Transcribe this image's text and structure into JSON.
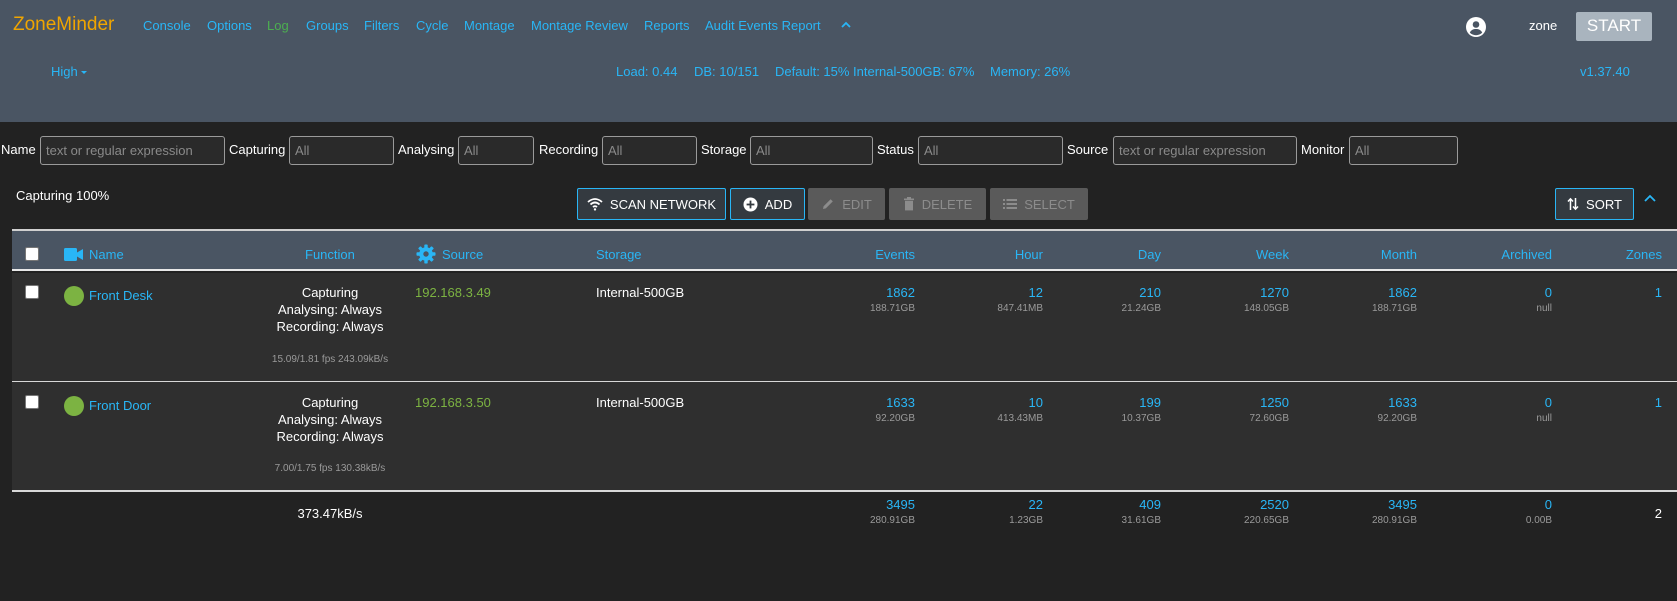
{
  "app": {
    "title": "ZoneMinder"
  },
  "nav": {
    "items": [
      "Console",
      "Options",
      "Log",
      "Groups",
      "Filters",
      "Cycle",
      "Montage",
      "Montage Review",
      "Reports",
      "Audit Events Report"
    ],
    "active": "Log"
  },
  "user": {
    "name": "zone"
  },
  "start_label": "START",
  "bandwidth": "High",
  "system": {
    "load": "Load: 0.44",
    "db": "DB: 10/151",
    "storage": "Default: 15% Internal-500GB: 67%",
    "memory": "Memory: 26%",
    "version": "v1.37.40"
  },
  "filters": {
    "name_label": "Name",
    "name_placeholder": "text or regular expression",
    "capturing_label": "Capturing",
    "capturing_value": "All",
    "analysing_label": "Analysing",
    "analysing_value": "All",
    "recording_label": "Recording",
    "recording_value": "All",
    "storage_label": "Storage",
    "storage_value": "All",
    "status_label": "Status",
    "status_value": "All",
    "source_label": "Source",
    "source_placeholder": "text or regular expression",
    "monitor_label": "Monitor",
    "monitor_value": "All"
  },
  "toolbar": {
    "capturing_status": "Capturing 100%",
    "scan_network": "SCAN NETWORK",
    "add": "ADD",
    "edit": "EDIT",
    "delete": "DELETE",
    "select": "SELECT",
    "sort": "SORT"
  },
  "table": {
    "headers": {
      "name": "Name",
      "function": "Function",
      "source": "Source",
      "storage": "Storage",
      "events": "Events",
      "hour": "Hour",
      "day": "Day",
      "week": "Week",
      "month": "Month",
      "archived": "Archived",
      "zones": "Zones"
    },
    "rows": [
      {
        "name": "Front Desk",
        "func": [
          "Capturing",
          "Analysing: Always",
          "Recording: Always"
        ],
        "fps": "15.09/1.81 fps 243.09kB/s",
        "source": "192.168.3.49",
        "storage": "Internal-500GB",
        "events": "1862",
        "events_size": "188.71GB",
        "hour": "12",
        "hour_size": "847.41MB",
        "day": "210",
        "day_size": "21.24GB",
        "week": "1270",
        "week_size": "148.05GB",
        "month": "1862",
        "month_size": "188.71GB",
        "archived": "0",
        "archived_size": "null",
        "zones": "1"
      },
      {
        "name": "Front Door",
        "func": [
          "Capturing",
          "Analysing: Always",
          "Recording: Always"
        ],
        "fps": "7.00/1.75 fps 130.38kB/s",
        "source": "192.168.3.50",
        "storage": "Internal-500GB",
        "events": "1633",
        "events_size": "92.20GB",
        "hour": "10",
        "hour_size": "413.43MB",
        "day": "199",
        "day_size": "10.37GB",
        "week": "1250",
        "week_size": "72.60GB",
        "month": "1633",
        "month_size": "92.20GB",
        "archived": "0",
        "archived_size": "null",
        "zones": "1"
      }
    ],
    "totals": {
      "bandwidth": "373.47kB/s",
      "events": "3495",
      "events_size": "280.91GB",
      "hour": "22",
      "hour_size": "1.23GB",
      "day": "409",
      "day_size": "31.61GB",
      "week": "2520",
      "week_size": "220.65GB",
      "month": "3495",
      "month_size": "280.91GB",
      "archived": "0",
      "archived_size": "0.00B",
      "zones": "2"
    }
  },
  "colors": {
    "header_bg": "#4a5563",
    "body_bg": "#222222",
    "accent": "#29b6f6",
    "logo": "#f0a500",
    "active_nav": "#4caf50",
    "status_ok": "#7cb342"
  }
}
